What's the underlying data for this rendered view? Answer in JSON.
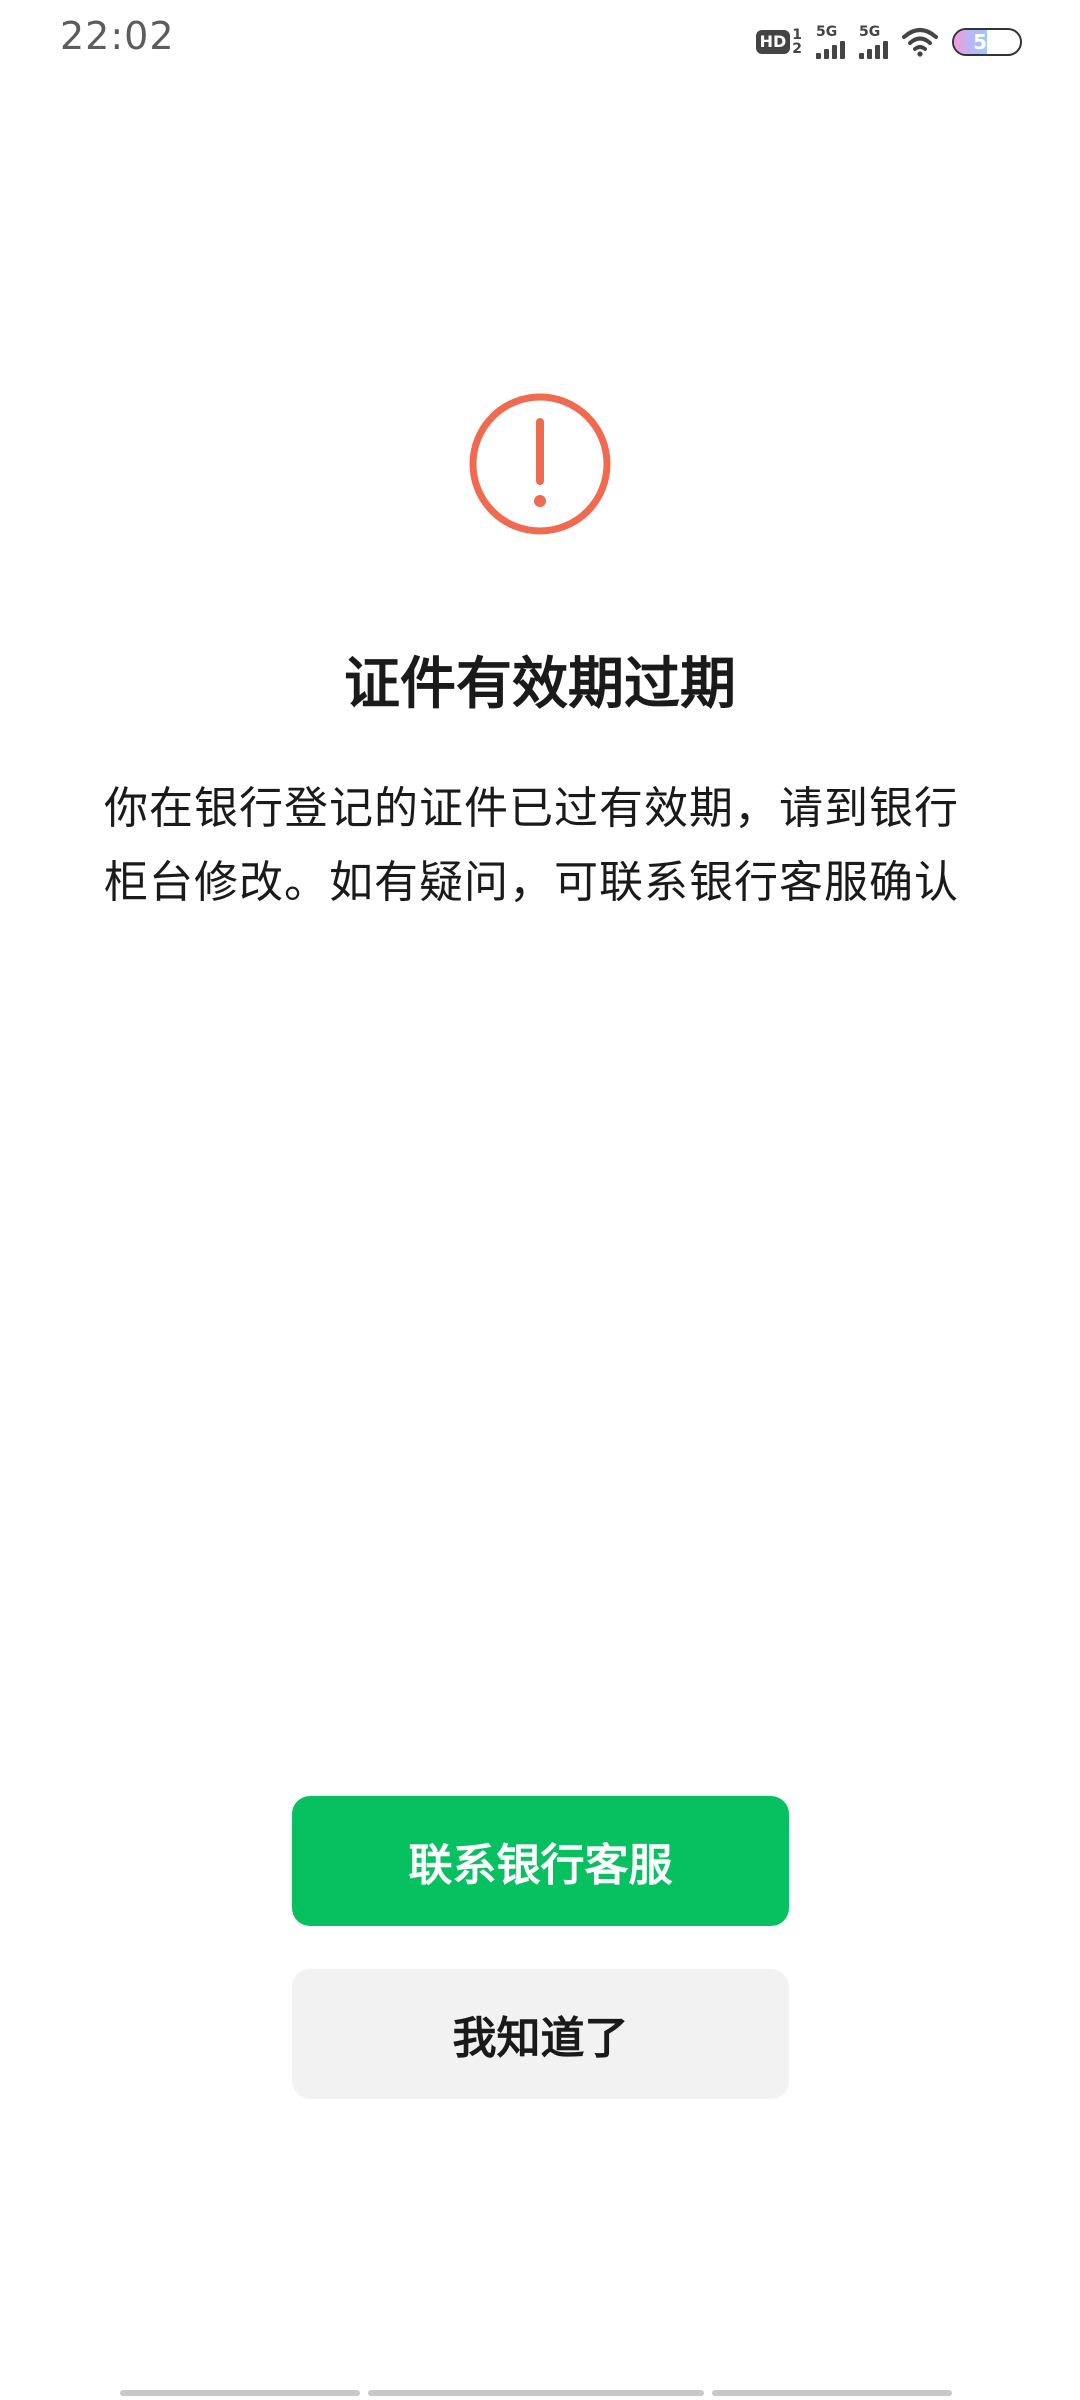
{
  "status_bar": {
    "time": "22:02",
    "hd_label": "HD",
    "hd_sim_top": "1",
    "hd_sim_bottom": "2",
    "sim1_network": "5G",
    "sim2_network": "5G",
    "battery_level": "50",
    "battery_fraction": 0.5,
    "icons": [
      "hd-icon",
      "signal-icon",
      "signal-icon",
      "wifi-icon",
      "battery-icon"
    ]
  },
  "dialog": {
    "icon": "exclamation-circle-icon",
    "icon_color": "#f06a50",
    "title": "证件有效期过期",
    "message": "你在银行登记的证件已过有效期，请到银行柜台修改。如有疑问，可联系银行客服确认"
  },
  "actions": {
    "primary_label": "联系银行客服",
    "secondary_label": "我知道了",
    "primary_color": "#07c160",
    "secondary_color": "#f2f2f2"
  }
}
